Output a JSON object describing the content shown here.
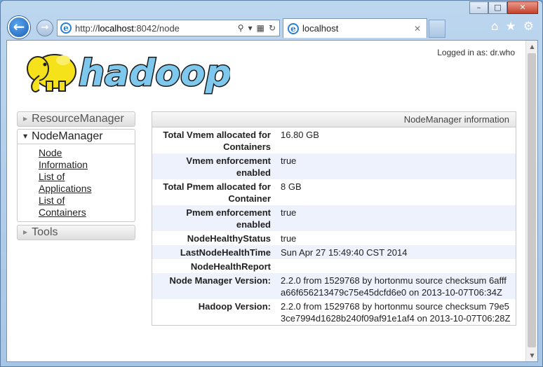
{
  "browser": {
    "url_prefix": "http://",
    "url_host": "localhost",
    "url_rest": ":8042/node",
    "tab_title": "localhost"
  },
  "header": {
    "login_text": "Logged in as: dr.who"
  },
  "sidebar": {
    "sections": [
      {
        "label": "ResourceManager",
        "expanded": false
      },
      {
        "label": "NodeManager",
        "expanded": true,
        "links": [
          "Node Information",
          "List of Applications",
          "List of Containers"
        ]
      },
      {
        "label": "Tools",
        "expanded": false
      }
    ]
  },
  "info": {
    "title": "NodeManager information",
    "rows": [
      {
        "key": "Total Vmem allocated for Containers",
        "value": "16.80 GB"
      },
      {
        "key": "Vmem enforcement enabled",
        "value": "true"
      },
      {
        "key": "Total Pmem allocated for Container",
        "value": "8 GB"
      },
      {
        "key": "Pmem enforcement enabled",
        "value": "true"
      },
      {
        "key": "NodeHealthyStatus",
        "value": "true"
      },
      {
        "key": "LastNodeHealthTime",
        "value": "Sun Apr 27 15:49:40 CST 2014"
      },
      {
        "key": "NodeHealthReport",
        "value": ""
      },
      {
        "key": "Node Manager Version:",
        "value": "2.2.0 from 1529768 by hortonmu source checksum 6afffa66f656213479c75e45dcfd6e0 on 2013-10-07T06:34Z"
      },
      {
        "key": "Hadoop Version:",
        "value": "2.2.0 from 1529768 by hortonmu source checksum 79e53ce7994d1628b240f09af91e1af4 on 2013-10-07T06:28Z"
      }
    ]
  },
  "logo": {
    "text": "hadoop",
    "fill_color": "#7ec8ee",
    "elephant_color": "#f5e21a"
  },
  "colors": {
    "row_alt": "#eef2fc",
    "link": "#222222"
  }
}
